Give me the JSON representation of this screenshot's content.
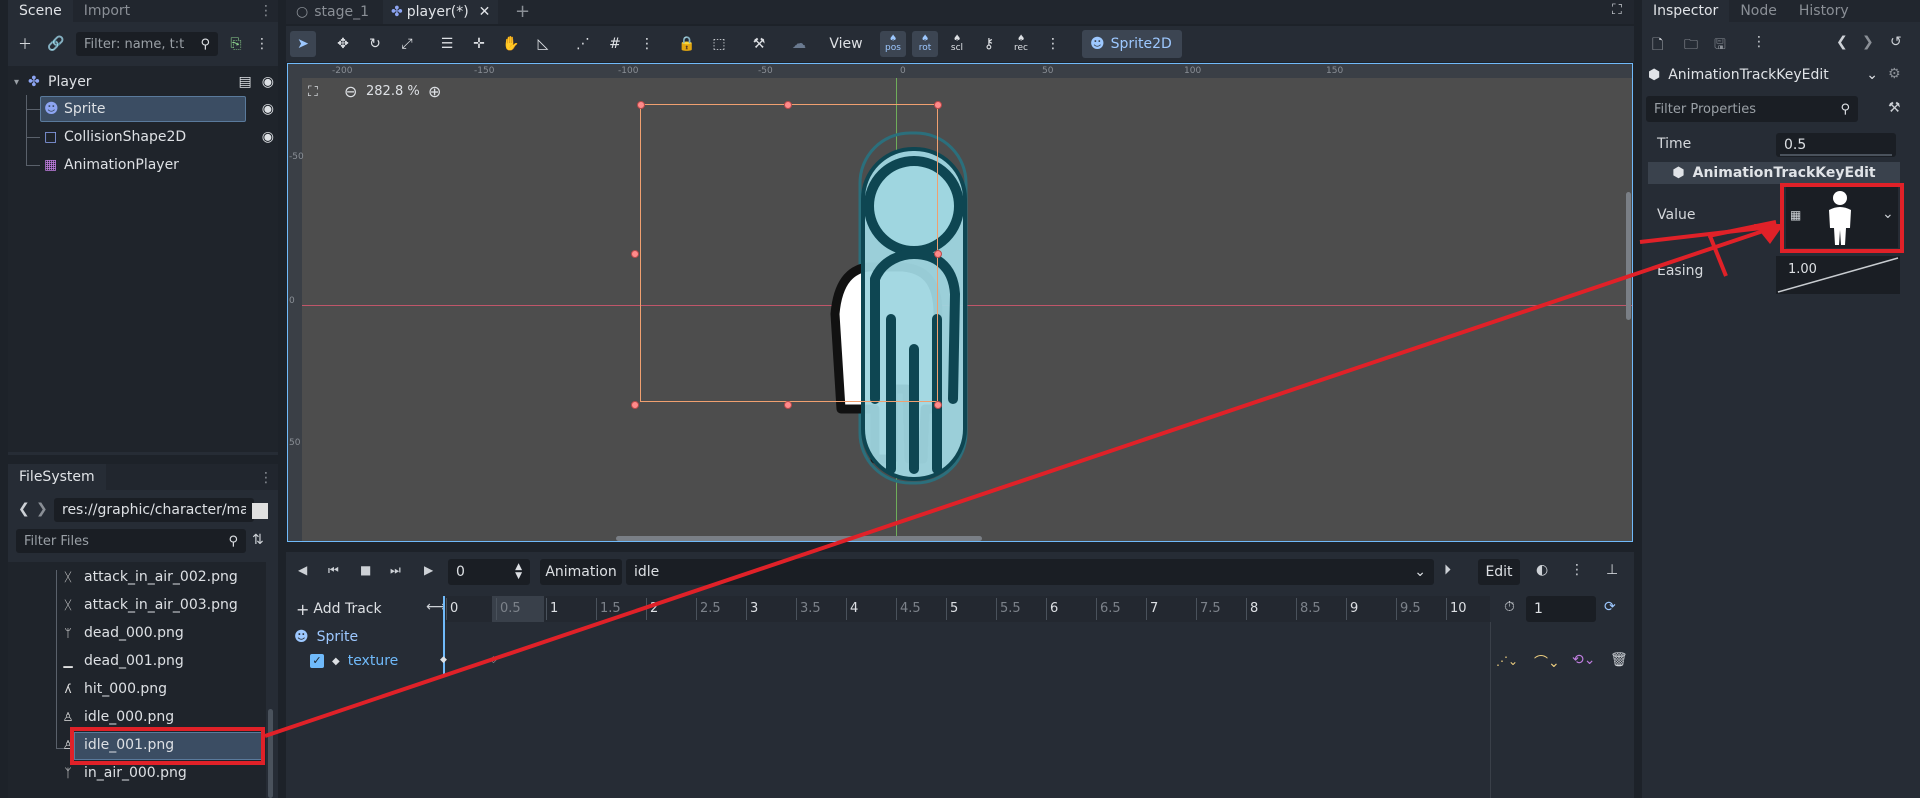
{
  "scene_dock": {
    "tabs": [
      "Scene",
      "Import"
    ],
    "filter_placeholder": "Filter: name, t:t",
    "nodes": [
      {
        "name": "Player",
        "type": "node2d"
      },
      {
        "name": "Sprite",
        "type": "sprite2d",
        "selected": true
      },
      {
        "name": "CollisionShape2D",
        "type": "collision"
      },
      {
        "name": "AnimationPlayer",
        "type": "animation"
      }
    ]
  },
  "filesystem": {
    "tab": "FileSystem",
    "path": "res://graphic/character/mai",
    "filter_placeholder": "Filter Files",
    "files": [
      {
        "name": "attack_in_air_002.png",
        "icon": "attack-pose"
      },
      {
        "name": "attack_in_air_003.png",
        "icon": "attack-pose"
      },
      {
        "name": "dead_000.png",
        "icon": "dead-pose"
      },
      {
        "name": "dead_001.png",
        "icon": "dead-pose"
      },
      {
        "name": "hit_000.png",
        "icon": "hit-pose"
      },
      {
        "name": "idle_000.png",
        "icon": "idle-pose"
      },
      {
        "name": "idle_001.png",
        "icon": "idle-pose",
        "selected": true
      },
      {
        "name": "in_air_000.png",
        "icon": "air-pose"
      }
    ]
  },
  "editor_tabs": [
    {
      "label": "stage_1",
      "active": false
    },
    {
      "label": "player(*)",
      "active": true
    }
  ],
  "toolbar": {
    "view_label": "View",
    "pos_label": "pos",
    "rot_label": "rot",
    "scl_label": "scl",
    "node_type": "Sprite2D"
  },
  "viewport": {
    "zoom": "282.8 %",
    "ruler_labels": [
      "-200",
      "-150",
      "-100",
      "-50",
      "0",
      "50",
      "100",
      "150"
    ],
    "ruler_v_labels": [
      "-50",
      "0",
      "50"
    ]
  },
  "animation_panel": {
    "time_value": "0",
    "animation_label": "Animation",
    "animation_name": "idle",
    "edit_label": "Edit",
    "add_track_label": "Add Track",
    "timeline_marks": [
      "0",
      "0.5",
      "1",
      "1.5",
      "2",
      "2.5",
      "3",
      "3.5",
      "4",
      "4.5",
      "5",
      "5.5",
      "6",
      "6.5",
      "7",
      "7.5",
      "8",
      "8.5",
      "9",
      "9.5",
      "10"
    ],
    "length_value": "1",
    "track_node": "Sprite",
    "track_property": "texture"
  },
  "inspector": {
    "tabs": [
      "Inspector",
      "Node",
      "History"
    ],
    "object_name": "AnimationTrackKeyEdit",
    "filter_placeholder": "Filter Properties",
    "section_title": "AnimationTrackKeyEdit",
    "properties": {
      "time_label": "Time",
      "time_value": "0.5",
      "value_label": "Value",
      "easing_label": "Easing",
      "easing_value": "1.00"
    }
  },
  "colors": {
    "accent": "#70bafa",
    "annotation_red": "#e02128",
    "selection_orange": "#f0a070",
    "character_fill": "#9fd6e0"
  }
}
